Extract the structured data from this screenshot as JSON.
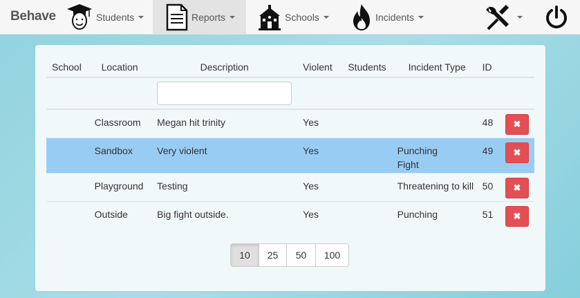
{
  "nav": {
    "brand": "Behave",
    "items": [
      {
        "label": "Students",
        "icon": "graduate-icon"
      },
      {
        "label": "Reports",
        "icon": "document-icon"
      },
      {
        "label": "Schools",
        "icon": "schoolhouse-icon"
      },
      {
        "label": "Incidents",
        "icon": "fire-icon"
      }
    ],
    "tools_icon": "wrench-screwdriver-icon",
    "power_icon": "power-icon"
  },
  "table": {
    "headers": [
      "School",
      "Location",
      "Description",
      "Violent",
      "Students",
      "Incident Type",
      "ID"
    ],
    "filter_placeholder": "",
    "rows": [
      {
        "school": "",
        "location": "Classroom",
        "description": "Megan hit trinity",
        "violent": "Yes",
        "students": "",
        "type1": "",
        "type2": "",
        "id": "48",
        "highlight": false
      },
      {
        "school": "",
        "location": "Sandbox",
        "description": "Very violent",
        "violent": "Yes",
        "students": "",
        "type1": "Punching",
        "type2": "Fight",
        "id": "49",
        "highlight": true
      },
      {
        "school": "",
        "location": "Playground",
        "description": "Testing",
        "violent": "Yes",
        "students": "",
        "type1": "Threatening to kill",
        "type2": "",
        "id": "50",
        "highlight": false
      },
      {
        "school": "",
        "location": "Outside",
        "description": "Big fight outside.",
        "violent": "Yes",
        "students": "",
        "type1": "Punching",
        "type2": "",
        "id": "51",
        "highlight": false
      }
    ],
    "delete_glyph": "✖"
  },
  "pagination": {
    "sizes": [
      "10",
      "25",
      "50",
      "100"
    ],
    "active": "10"
  },
  "colors": {
    "highlight_row": "#99ccf3",
    "delete_button": "#e25055",
    "background": "#a9dde6"
  }
}
